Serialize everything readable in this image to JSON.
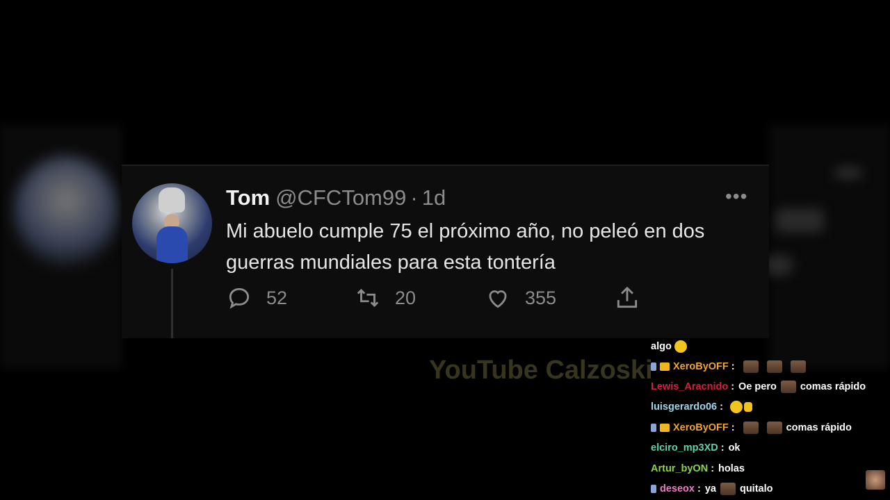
{
  "tweet": {
    "name": "Tom",
    "handle": "@CFCTom99",
    "separator": "·",
    "time": "1d",
    "more": "•••",
    "text": "Mi abuelo cumple 75 el próximo año, no peleó en dos guerras mundiales para esta tontería",
    "replies": "52",
    "retweets": "20",
    "likes": "355"
  },
  "watermark": "YouTube Calzoski",
  "chat": [
    {
      "user": "",
      "message": "algo",
      "user_color": "#ffffff",
      "badges": [],
      "emotes": [
        "smile-emote"
      ]
    },
    {
      "user": "XeroByOFF",
      "message": "",
      "user_color": "#f4a52a",
      "badges": [
        "mod",
        "crown"
      ],
      "emotes": [
        "brown-emote",
        "brown-emote",
        "brown-emote"
      ]
    },
    {
      "user": "Lewis_Aracnido",
      "message": "Oe pero",
      "message2": "comas rápido",
      "user_color": "#d6203a",
      "badges": [],
      "emotes": [
        "brown-emote"
      ]
    },
    {
      "user": "luisgerardo06",
      "message": "",
      "user_color": "#9fd6e8",
      "badges": [],
      "emotes": [
        "face-emote",
        "hand-emote"
      ]
    },
    {
      "user": "XeroByOFF",
      "message": "comas rápido",
      "user_color": "#f4a52a",
      "badges": [
        "mod",
        "crown"
      ],
      "emotes": [
        "brown-emote",
        "brown-emote"
      ]
    },
    {
      "user": "elciro_mp3XD",
      "message": "ok",
      "user_color": "#5fd1b0",
      "badges": [],
      "emotes": []
    },
    {
      "user": "Artur_byON",
      "message": "holas",
      "user_color": "#8bd44a",
      "badges": [],
      "emotes": []
    },
    {
      "user": "deseox",
      "message": "ya",
      "message2": "quitalo",
      "user_color": "#f07ac6",
      "badges": [
        "mod"
      ],
      "emotes": [
        "brown-emote"
      ]
    }
  ],
  "chat_separator": ":",
  "colors": {
    "background": "#000000",
    "card": "#0d0d0d",
    "secondary_text": "#8c8c8c"
  }
}
